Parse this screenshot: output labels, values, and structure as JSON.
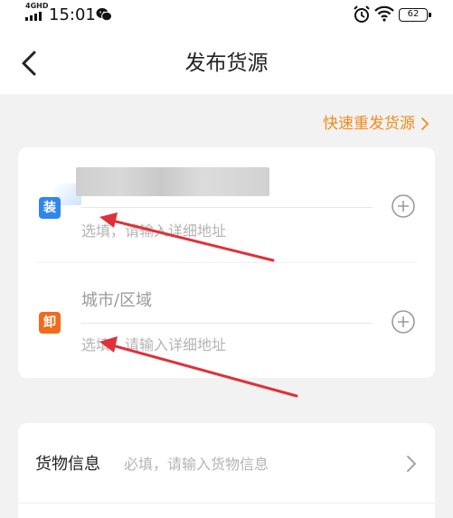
{
  "status_bar": {
    "network": "4GHD",
    "time": "15:01",
    "battery": "62",
    "icons": [
      "signal-icon",
      "wechat-icon",
      "alarm-icon",
      "wifi-icon",
      "battery-icon"
    ]
  },
  "nav": {
    "title": "发布货源",
    "back_icon": "chevron-left-icon"
  },
  "quick_repost": {
    "label": "快速重发货源",
    "icon": "chevron-right-icon"
  },
  "loading": {
    "badge": "装",
    "address_placeholder": "选填，请输入详细地址",
    "add_icon": "plus-circle-icon"
  },
  "unloading": {
    "badge": "卸",
    "city_placeholder": "城市/区域",
    "address_placeholder": "选填，请输入详细地址",
    "add_icon": "plus-circle-icon"
  },
  "cargo": {
    "label": "货物信息",
    "placeholder": "必填，请输入货物信息",
    "icon": "chevron-right-icon"
  },
  "colors": {
    "accent_orange": "#f08c1d",
    "load_badge": "#2f86f0",
    "unload_badge": "#f26a1b",
    "annotation_arrow": "#e0303a",
    "background": "#f2f2f2"
  }
}
